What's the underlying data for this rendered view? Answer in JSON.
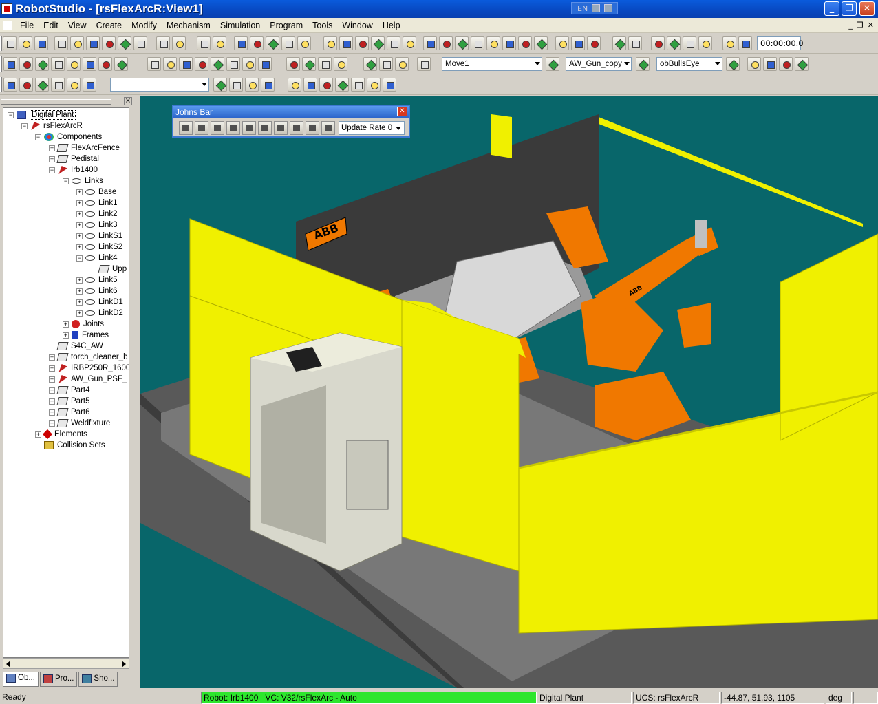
{
  "app": {
    "title": "RobotStudio - [rsFlexArcR:View1]",
    "language": "EN"
  },
  "window_controls": {
    "minimize": "_",
    "maximize": "❐",
    "close": "✕"
  },
  "mdi_controls": {
    "minimize": "_",
    "restore": "❐",
    "close": "✕"
  },
  "menu": [
    "File",
    "Edit",
    "View",
    "Create",
    "Modify",
    "Mechanism",
    "Simulation",
    "Program",
    "Tools",
    "Window",
    "Help"
  ],
  "toolbar": {
    "timer": "00:00:00.0",
    "path_combo": "Move1",
    "tool_combo": "AW_Gun_copy",
    "workobject_combo": "obBullsEye",
    "empty_combo": ""
  },
  "tree": {
    "items": [
      {
        "label": "Digital Plant",
        "indent": 0,
        "expander": "−",
        "icon": "plant"
      },
      {
        "label": "rsFlexArcR",
        "indent": 1,
        "expander": "−",
        "icon": "robot"
      },
      {
        "label": "Components",
        "indent": 2,
        "expander": "−",
        "icon": "comp"
      },
      {
        "label": "FlexArcFence",
        "indent": 3,
        "expander": "+",
        "icon": "part"
      },
      {
        "label": "Pedistal",
        "indent": 3,
        "expander": "+",
        "icon": "part"
      },
      {
        "label": "Irb1400",
        "indent": 3,
        "expander": "−",
        "icon": "robot"
      },
      {
        "label": "Links",
        "indent": 4,
        "expander": "−",
        "icon": "link"
      },
      {
        "label": "Base",
        "indent": 5,
        "expander": "+",
        "icon": "link"
      },
      {
        "label": "Link1",
        "indent": 5,
        "expander": "+",
        "icon": "link"
      },
      {
        "label": "Link2",
        "indent": 5,
        "expander": "+",
        "icon": "link"
      },
      {
        "label": "Link3",
        "indent": 5,
        "expander": "+",
        "icon": "link"
      },
      {
        "label": "LinkS1",
        "indent": 5,
        "expander": "+",
        "icon": "link"
      },
      {
        "label": "LinkS2",
        "indent": 5,
        "expander": "+",
        "icon": "link"
      },
      {
        "label": "Link4",
        "indent": 5,
        "expander": "−",
        "icon": "link"
      },
      {
        "label": "Upp",
        "indent": 6,
        "expander": "",
        "icon": "part"
      },
      {
        "label": "Link5",
        "indent": 5,
        "expander": "+",
        "icon": "link"
      },
      {
        "label": "Link6",
        "indent": 5,
        "expander": "+",
        "icon": "link"
      },
      {
        "label": "LinkD1",
        "indent": 5,
        "expander": "+",
        "icon": "link"
      },
      {
        "label": "LinkD2",
        "indent": 5,
        "expander": "+",
        "icon": "link"
      },
      {
        "label": "Joints",
        "indent": 4,
        "expander": "+",
        "icon": "joint"
      },
      {
        "label": "Frames",
        "indent": 4,
        "expander": "+",
        "icon": "frame"
      },
      {
        "label": "S4C_AW",
        "indent": 3,
        "expander": "",
        "icon": "part"
      },
      {
        "label": "torch_cleaner_b",
        "indent": 3,
        "expander": "+",
        "icon": "part"
      },
      {
        "label": "IRBP250R_1600",
        "indent": 3,
        "expander": "+",
        "icon": "robot"
      },
      {
        "label": "AW_Gun_PSF_",
        "indent": 3,
        "expander": "+",
        "icon": "robot"
      },
      {
        "label": "Part4",
        "indent": 3,
        "expander": "+",
        "icon": "part"
      },
      {
        "label": "Part5",
        "indent": 3,
        "expander": "+",
        "icon": "part"
      },
      {
        "label": "Part6",
        "indent": 3,
        "expander": "+",
        "icon": "part"
      },
      {
        "label": "Weldfixture",
        "indent": 3,
        "expander": "+",
        "icon": "part"
      },
      {
        "label": "Elements",
        "indent": 2,
        "expander": "+",
        "icon": "elem"
      },
      {
        "label": "Collision Sets",
        "indent": 2,
        "expander": "",
        "icon": "coll"
      }
    ]
  },
  "panel_tabs": [
    {
      "label": "Ob..."
    },
    {
      "label": "Pro..."
    },
    {
      "label": "Sho..."
    }
  ],
  "johns_bar": {
    "title": "Johns Bar",
    "update_rate": "Update Rate 0"
  },
  "viewport": {
    "sign_text": "ABB",
    "robot_text": "ABB"
  },
  "status": {
    "ready": "Ready",
    "robot": "Robot: Irb1400",
    "vc": "VC: V32/rsFlexArc - Auto",
    "plant": "Digital Plant",
    "ucs": "UCS: rsFlexArcR",
    "coords": "-44.87, 51.93, 1105",
    "unit": "deg"
  },
  "colors": {
    "title_bar": "#0848c0",
    "viewport_bg": "#08666a",
    "fence": "#f0f000",
    "robot": "#f07800",
    "status_green": "#2de62d"
  }
}
